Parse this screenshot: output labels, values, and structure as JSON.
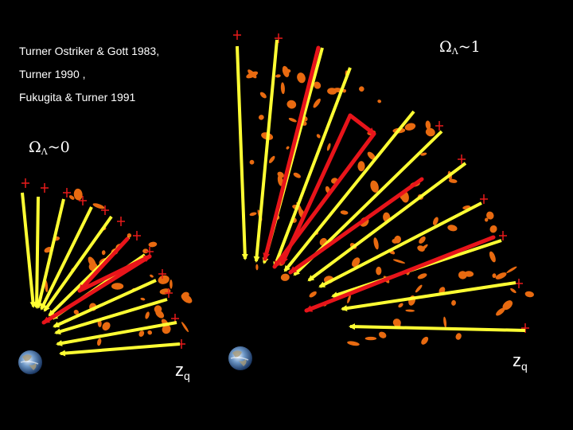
{
  "references": [
    "Turner Ostriker & Gott 1983,",
    "Turner 1990 ,",
    "Fukugita & Turner 1991"
  ],
  "omega_right": {
    "symbol": "Ω",
    "subscript": "Λ",
    "relation": "~1"
  },
  "omega_left": {
    "symbol": "Ω",
    "subscript": "Λ",
    "relation": "~0"
  },
  "zq_left": {
    "base": "z",
    "subscript": "q"
  },
  "zq_right": {
    "base": "z",
    "subscript": "q"
  },
  "colors": {
    "background": "#000000",
    "yellow_ray": "#ffff33",
    "red_ray": "#e8141a",
    "galaxy": "#e86a10",
    "quasar_star": "#e81a1a"
  },
  "icons": {
    "earth_left": "earth-icon",
    "earth_right": "earth-icon"
  }
}
